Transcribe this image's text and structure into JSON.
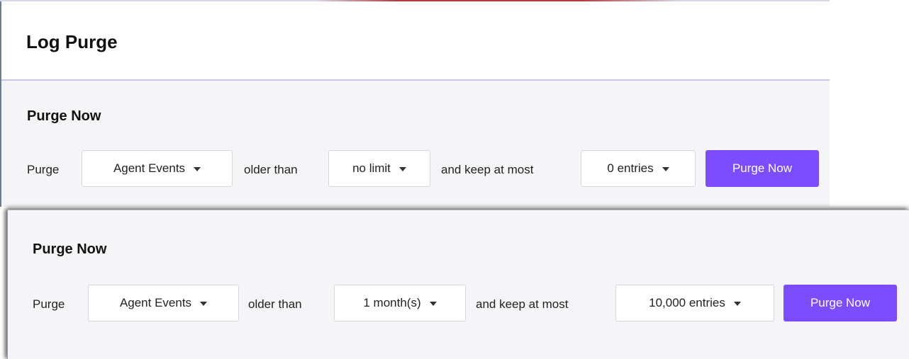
{
  "page_title": "Log Purge",
  "panel_before": {
    "section_title": "Purge Now",
    "purge_label": "Purge",
    "log_type": "Agent Events",
    "older_than_label": "older than",
    "age": "no limit",
    "keep_label": "and keep at most",
    "entries": "0 entries",
    "button_label": "Purge Now"
  },
  "panel_after": {
    "section_title": "Purge Now",
    "purge_label": "Purge",
    "log_type": "Agent Events",
    "older_than_label": "older than",
    "age": "1 month(s)",
    "keep_label": "and keep at most",
    "entries": "10,000 entries",
    "button_label": "Purge Now"
  },
  "colors": {
    "accent": "#7c4dff",
    "panel_bg": "#f5f5f8"
  },
  "icons": {
    "dropdown": "caret-down-icon"
  }
}
